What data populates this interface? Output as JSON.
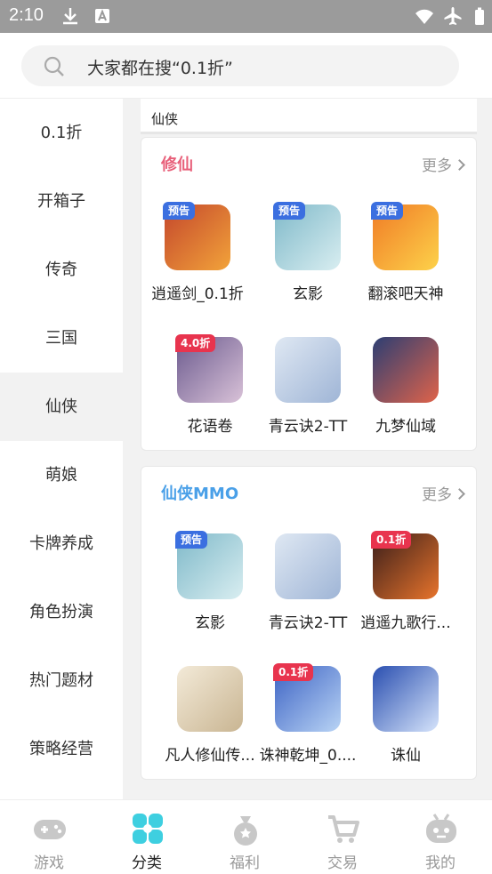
{
  "status_bar": {
    "time": "2:10"
  },
  "search": {
    "placeholder": "大家都在搜“0.1折”"
  },
  "sidebar": {
    "items": [
      {
        "label": "0.1折"
      },
      {
        "label": "开箱子"
      },
      {
        "label": "传奇"
      },
      {
        "label": "三国"
      },
      {
        "label": "仙侠",
        "active": true
      },
      {
        "label": "萌娘"
      },
      {
        "label": "卡牌养成"
      },
      {
        "label": "角色扮演"
      },
      {
        "label": "热门题材"
      },
      {
        "label": "策略经营"
      }
    ]
  },
  "main": {
    "breadcrumb": "仙侠",
    "sections": [
      {
        "title": "修仙",
        "title_color": "#e8607a",
        "more_label": "更多",
        "games": [
          {
            "name": "逍遥剑_0.1折",
            "badge": "预告",
            "badge_style": "blue",
            "colors": [
              "#c4472c",
              "#f2a33a"
            ]
          },
          {
            "name": "玄影",
            "badge": "预告",
            "badge_style": "blue",
            "colors": [
              "#7fb9c9",
              "#d9eef1"
            ]
          },
          {
            "name": "翻滚吧天神",
            "badge": "预告",
            "badge_style": "blue",
            "colors": [
              "#f07b26",
              "#fdd24a"
            ]
          },
          {
            "name": "花语卷",
            "badge": "4.0折",
            "badge_style": "red",
            "colors": [
              "#6b5a8e",
              "#d9c2d8"
            ]
          },
          {
            "name": "青云诀2-TT",
            "badge": "",
            "badge_style": "",
            "colors": [
              "#dfe8f3",
              "#9fb5d6"
            ]
          },
          {
            "name": "九梦仙域",
            "badge": "",
            "badge_style": "",
            "colors": [
              "#2c3e73",
              "#e0634a"
            ]
          }
        ]
      },
      {
        "title": "仙侠MMO",
        "title_color": "#4aa0e8",
        "more_label": "更多",
        "games": [
          {
            "name": "玄影",
            "badge": "预告",
            "badge_style": "blue",
            "colors": [
              "#7fb9c9",
              "#d9eef1"
            ]
          },
          {
            "name": "青云诀2-TT",
            "badge": "",
            "badge_style": "",
            "colors": [
              "#dfe8f3",
              "#9fb5d6"
            ]
          },
          {
            "name": "逍遥九歌行...",
            "badge": "0.1折",
            "badge_style": "red",
            "colors": [
              "#3a1e1a",
              "#e8742c"
            ]
          },
          {
            "name": "凡人修仙传...",
            "badge": "",
            "badge_style": "",
            "colors": [
              "#f3ead8",
              "#c9b592"
            ]
          },
          {
            "name": "诛神乾坤_0....",
            "badge": "0.1折",
            "badge_style": "red",
            "colors": [
              "#3d63c4",
              "#b9d4f5"
            ]
          },
          {
            "name": "诛仙",
            "badge": "",
            "badge_style": "",
            "colors": [
              "#2a4fb0",
              "#d6e4fb"
            ]
          }
        ]
      }
    ]
  },
  "bottom_nav": {
    "tabs": [
      {
        "label": "游戏",
        "icon": "gamepad-icon"
      },
      {
        "label": "分类",
        "icon": "category-icon",
        "active": true
      },
      {
        "label": "福利",
        "icon": "gift-bag-icon"
      },
      {
        "label": "交易",
        "icon": "cart-icon"
      },
      {
        "label": "我的",
        "icon": "profile-robot-icon"
      }
    ]
  },
  "colors": {
    "accent": "#3ecfe0",
    "active_bg": "#f2f2f2",
    "inactive_tab": "#c8c8c8"
  }
}
